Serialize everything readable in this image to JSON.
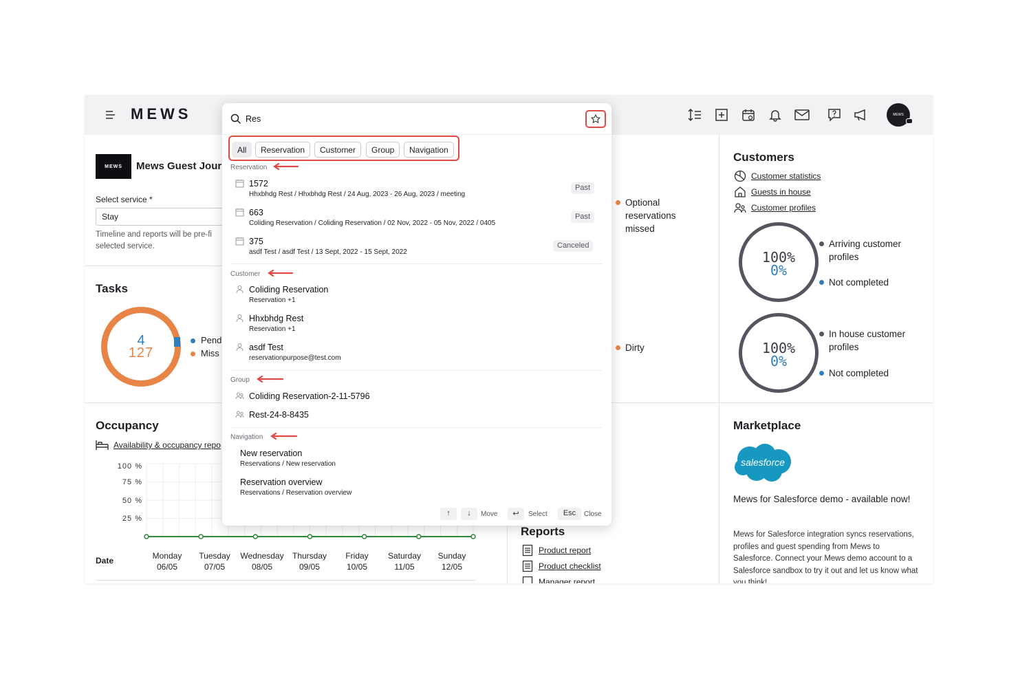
{
  "topbar": {
    "logo": "MEWS",
    "avatar_text": "MEWS",
    "icons": [
      "sort-icon",
      "add-box-icon",
      "calendar-icon",
      "bell-icon",
      "mail-icon",
      "help-icon",
      "megaphone-icon"
    ]
  },
  "guest_journey": {
    "logo_text": "MEWS",
    "title": "Mews Guest Jour",
    "service_label": "Select service *",
    "service_value": "Stay",
    "help_text": "Timeline and reports will be pre-fi selected service."
  },
  "tasks": {
    "title": "Tasks",
    "value_blue": "4",
    "value_orange": "127",
    "legend": [
      "Pend",
      "Miss"
    ]
  },
  "middle": {
    "optional_missed": "Optional reservations missed",
    "dirty": "Dirty"
  },
  "customers": {
    "title": "Customers",
    "links": [
      "Customer statistics",
      "Guests in house",
      "Customer profiles"
    ],
    "ring1": {
      "top": "100%",
      "bottom": "0%",
      "legend_a": "Arriving customer profiles",
      "legend_b": "Not completed"
    },
    "ring2": {
      "top": "100%",
      "bottom": "0%",
      "legend_a": "In house customer profiles",
      "legend_b": "Not completed"
    }
  },
  "occupancy": {
    "title": "Occupancy",
    "link": "Availability & occupancy repo",
    "date_label": "Date",
    "y_labels": [
      "100 %",
      "75 %",
      "50 %",
      "25 %"
    ],
    "days": [
      {
        "name": "Monday",
        "date": "06/05"
      },
      {
        "name": "Tuesday",
        "date": "07/05"
      },
      {
        "name": "Wednesday",
        "date": "08/05"
      },
      {
        "name": "Thursday",
        "date": "09/05"
      },
      {
        "name": "Friday",
        "date": "10/05"
      },
      {
        "name": "Saturday",
        "date": "11/05"
      },
      {
        "name": "Sunday",
        "date": "12/05"
      }
    ],
    "values": [
      0,
      0,
      0,
      0,
      0,
      0,
      0
    ]
  },
  "reports": {
    "title": "Reports",
    "links": [
      "Product report",
      "Product checklist",
      "Manager report"
    ]
  },
  "marketplace": {
    "title": "Marketplace",
    "logo_text": "salesforce",
    "headline": "Mews for Salesforce demo - available now!",
    "description": "Mews for Salesforce integration syncs reservations, profiles and guest spending from Mews to Salesforce. Connect your Mews demo account to a Salesforce sandbox to try it out and let us know what you think!"
  },
  "search": {
    "query": "Res",
    "filters": [
      "All",
      "Reservation",
      "Customer",
      "Group",
      "Navigation"
    ],
    "groups": {
      "reservation": "Reservation",
      "customer": "Customer",
      "group": "Group",
      "navigation": "Navigation"
    },
    "reservations": [
      {
        "title": "1572",
        "sub": "Hhxbhdg Rest / Hhxbhdg Rest / 24 Aug, 2023 - 26 Aug, 2023 / meeting",
        "status": "Past"
      },
      {
        "title": "663",
        "sub": "Coliding Reservation /  Coliding Reservation / 02 Nov, 2022 - 05 Nov, 2022 / 0405",
        "status": "Past"
      },
      {
        "title": "375",
        "sub": "asdf Test / asdf Test / 13 Sept, 2022 - 15 Sept, 2022",
        "status": "Canceled"
      }
    ],
    "customers": [
      {
        "title": "Coliding Reservation",
        "sub": "Reservation +1"
      },
      {
        "title": "Hhxbhdg Rest",
        "sub": "Reservation +1"
      },
      {
        "title": "asdf Test",
        "sub": "reservationpurpose@test.com"
      }
    ],
    "groups_list": [
      {
        "title": "Coliding Reservation-2-11-5796"
      },
      {
        "title": "Rest-24-8-8435"
      }
    ],
    "navigation": [
      {
        "title": "New reservation",
        "sub": "Reservations / New reservation"
      },
      {
        "title": "Reservation overview",
        "sub": "Reservations / Reservation overview"
      }
    ],
    "footer": {
      "move": "Move",
      "select": "Select",
      "esc": "Esc",
      "close": "Close"
    }
  },
  "colors": {
    "accent_red": "#e04a46",
    "orange": "#e98447",
    "blue": "#2f7fbf",
    "green": "#2e8b3a",
    "salesforce": "#1798c1"
  }
}
